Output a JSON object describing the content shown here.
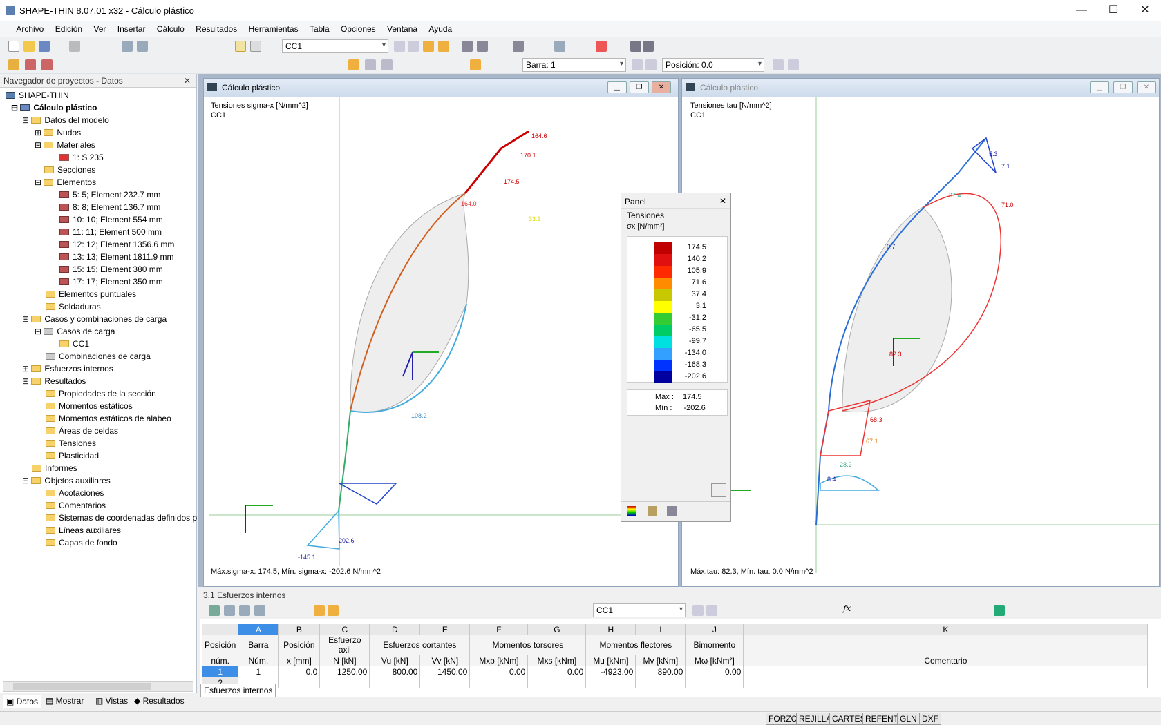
{
  "app": {
    "title": "SHAPE-THIN 8.07.01 x32 - Cálculo plástico"
  },
  "menu": [
    "Archivo",
    "Edición",
    "Ver",
    "Insertar",
    "Cálculo",
    "Resultados",
    "Herramientas",
    "Tabla",
    "Opciones",
    "Ventana",
    "Ayuda"
  ],
  "toolbar": {
    "loadcase": "CC1",
    "bar": "Barra: 1",
    "position": "Posición: 0.0"
  },
  "navigator": {
    "title": "Navegador de proyectos - Datos",
    "items": [
      "SHAPE-THIN",
      "Cálculo plástico",
      "Datos del modelo",
      "Nudos",
      "Materiales",
      "1: S 235",
      "Secciones",
      "Elementos",
      "5: 5; Element 232.7 mm",
      "8: 8; Element 136.7 mm",
      "10: 10; Element 554 mm",
      "11: 11; Element 500 mm",
      "12: 12; Element 1356.6 mm",
      "13: 13; Element 1811.9 mm",
      "15: 15; Element 380 mm",
      "17: 17; Element 350 mm",
      "Elementos puntuales",
      "Soldaduras",
      "Casos y combinaciones de carga",
      "Casos de carga",
      "CC1",
      "Combinaciones de carga",
      "Esfuerzos internos",
      "Resultados",
      "Propiedades de la sección",
      "Momentos estáticos",
      "Momentos estáticos de alabeo",
      "Áreas de celdas",
      "Tensiones",
      "Plasticidad",
      "Informes",
      "Objetos auxiliares",
      "Acotaciones",
      "Comentarios",
      "Sistemas de coordenadas definidos p",
      "Líneas auxiliares",
      "Capas de fondo"
    ],
    "tabs": [
      "Datos",
      "Mostrar",
      "Vistas",
      "Resultados"
    ]
  },
  "win1": {
    "title": "Cálculo plástico",
    "l1": "Tensiones sigma-x [N/mm^2]",
    "l2": "CC1",
    "footer": "Máx.sigma-x: 174.5, Mín. sigma-x: -202.6 N/mm^2",
    "labels": [
      "164.6",
      "170.1",
      "174.5",
      "164.0",
      "33.1",
      "108.2",
      "-145.1",
      "-202.6"
    ]
  },
  "win2": {
    "title": "Cálculo plástico",
    "l1": "Tensiones tau [N/mm^2]",
    "l2": "CC1",
    "footer": "Máx.tau: 82.3, Mín. tau: 0.0 N/mm^2",
    "labels": [
      "5.3",
      "7.1",
      "71.0",
      "37.4",
      "0.7",
      "82.3",
      "68.3",
      "67.1",
      "28.2",
      "8.4"
    ]
  },
  "panel": {
    "title": "Panel",
    "h1": "Tensiones",
    "h2": "σx [N/mm²]",
    "legend": [
      "174.5",
      "140.2",
      "105.9",
      "71.6",
      "37.4",
      "3.1",
      "-31.2",
      "-65.5",
      "-99.7",
      "-134.0",
      "-168.3",
      "-202.6"
    ],
    "colors": [
      "#c00000",
      "#e01010",
      "#ff2a00",
      "#ff8c00",
      "#c8c800",
      "#ffff00",
      "#33cc33",
      "#00cc66",
      "#00e0e0",
      "#33a0ff",
      "#0033ff",
      "#0000a0"
    ],
    "max_label": "Máx",
    "max": "174.5",
    "min_label": "Mín",
    "min": "-202.6"
  },
  "table": {
    "title": "3.1 Esfuerzos internos",
    "loadcase": "CC1",
    "cols": [
      "A",
      "B",
      "C",
      "D",
      "E",
      "F",
      "G",
      "H",
      "I",
      "J",
      "K"
    ],
    "h1": [
      "Posición",
      "Barra",
      "Posición",
      "Esfuerzo axil",
      "Esfuerzos cortantes",
      "",
      "Momentos torsores",
      "",
      "Momentos flectores",
      "",
      "Bimomento",
      ""
    ],
    "h2": [
      "núm.",
      "Núm.",
      "x [mm]",
      "N [kN]",
      "Vu [kN]",
      "Vv [kN]",
      "Mxp [kNm]",
      "Mxs [kNm]",
      "Mu [kNm]",
      "Mv [kNm]",
      "Mω [kNm²]",
      "Comentario"
    ],
    "rows": [
      [
        "1",
        "1",
        "0.0",
        "1250.00",
        "800.00",
        "1450.00",
        "0.00",
        "0.00",
        "-4923.00",
        "890.00",
        "0.00",
        ""
      ],
      [
        "2",
        "",
        "",
        "",
        "",
        "",
        "",
        "",
        "",
        "",
        "",
        ""
      ]
    ],
    "tab": "Esfuerzos internos"
  },
  "status": [
    "FORZC",
    "REJILLA",
    "CARTES",
    "REFENT",
    "GLN",
    "DXF"
  ]
}
